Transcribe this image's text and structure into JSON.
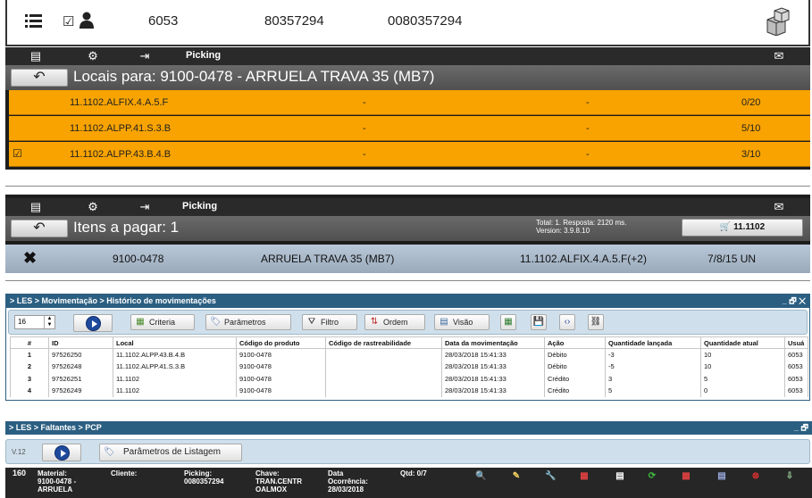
{
  "header": {
    "menu_icon": "hamburger-icon",
    "check_icon": "checkbox-icon",
    "user_icon": "user-icon",
    "box_icon": "boxes-icon",
    "field1": "6053",
    "field2": "80357294",
    "field3": "0080357294"
  },
  "picking1": {
    "toolbar_label": "Picking",
    "title": "Locais para: 9100-0478 - ARRUELA TRAVA 35 (MB7)",
    "rows": [
      {
        "checked": false,
        "location": "11.1102.ALFIX.4.A.5.F",
        "col2": "-",
        "col3": "-",
        "qty": "0/20"
      },
      {
        "checked": false,
        "location": "11.1102.ALPP.41.S.3.B",
        "col2": "-",
        "col3": "-",
        "qty": "5/10"
      },
      {
        "checked": true,
        "location": "11.1102.ALPP.43.B.4.B",
        "col2": "-",
        "col3": "-",
        "qty": "3/10"
      }
    ]
  },
  "picking2": {
    "toolbar_label": "Picking",
    "title": "Itens a pagar: 1",
    "info_line1": "Total: 1. Resposta: 2120 ms.",
    "info_line2": "Version: 3.9.8.10",
    "cart_label": "11.1102",
    "item": {
      "code": "9100-0478",
      "description": "ARRUELA TRAVA 35 (MB7)",
      "location": "11.1102.ALFIX.4.A.5.F(+2)",
      "qty": "7/8/15 UN"
    }
  },
  "historico": {
    "breadcrumb": "> LES > Movimentação > Histórico de movimentações",
    "window_buttons": "_ 🗗 ✕",
    "spinner_value": "16",
    "buttons": {
      "criteria": "Criteria",
      "parametros": "Parâmetros",
      "filtro": "Filtro",
      "ordem": "Ordem",
      "visao": "Visão"
    },
    "columns": [
      "#",
      "ID",
      "Local",
      "Código do produto",
      "Código de rastreabilidade",
      "Data da movimentação",
      "Ação",
      "Quantidade lançada",
      "Quantidade atual",
      "Usuá"
    ],
    "rows": [
      [
        "1",
        "97526250",
        "11.1102.ALPP.43.B.4.B",
        "9100-0478",
        "",
        "28/03/2018 15:41:33",
        "Débito",
        "-3",
        "10",
        "6053"
      ],
      [
        "2",
        "97526248",
        "11.1102.ALPP.41.S.3.B",
        "9100-0478",
        "",
        "28/03/2018 15:41:33",
        "Débito",
        "-5",
        "10",
        "6053"
      ],
      [
        "3",
        "97526251",
        "11.1102",
        "9100-0478",
        "",
        "28/03/2018 15:41:33",
        "Crédito",
        "3",
        "5",
        "6053"
      ],
      [
        "4",
        "97526249",
        "11.1102",
        "9100-0478",
        "",
        "28/03/2018 15:41:33",
        "Crédito",
        "5",
        "0",
        "6053"
      ]
    ]
  },
  "faltantes": {
    "breadcrumb": "> LES > Faltantes > PCP",
    "version": "V.12",
    "param_button": "Parâmetros de Listagem",
    "row": {
      "id": "160",
      "material_label": "Material:",
      "material_value": "9100-0478 -",
      "material_value2": "ARRUELA",
      "cliente_label": "Cliente:",
      "picking_label": "Picking:",
      "picking_value": "0080357294",
      "chave_label": "Chave:",
      "chave_value": "TRAN.CENTR",
      "chave_value2": "OALMOX",
      "data_label": "Data",
      "data_label2": "Ocorrência:",
      "data_value": "28/03/2018",
      "qtd": "Qtd: 0/7"
    }
  }
}
